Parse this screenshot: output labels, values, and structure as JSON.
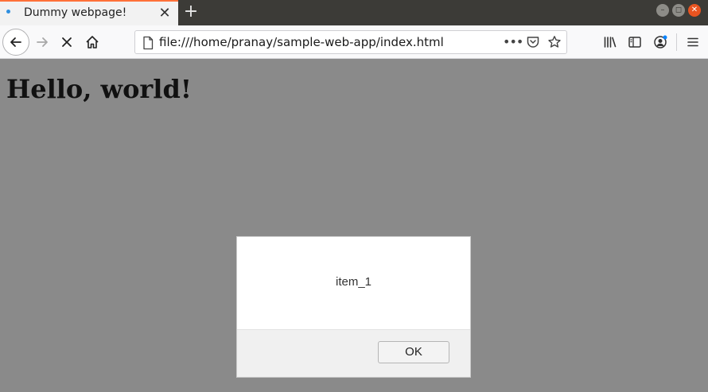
{
  "tab": {
    "title": "Dummy webpage!",
    "close_glyph": "✕",
    "dot_color": "#2f8fe0"
  },
  "new_tab_glyph": "+",
  "window_controls": {
    "minimize": "–",
    "maximize": "◻",
    "close": "✕"
  },
  "urlbar": {
    "url": "file:///home/pranay/sample-web-app/index.html",
    "more_glyph": "•••"
  },
  "icons": [
    "back-arrow-icon",
    "forward-arrow-icon",
    "stop-icon",
    "home-icon",
    "page-icon",
    "pocket-icon",
    "bookmark-star-icon",
    "library-icon",
    "sidebar-icon",
    "account-icon",
    "hamburger-menu-icon"
  ],
  "page": {
    "heading": "Hello, world!"
  },
  "dialog": {
    "message": "item_1",
    "ok_label": "OK"
  },
  "colors": {
    "accent": "#ff7139",
    "page_overlay": "#8a8a8a",
    "close_button": "#e95420"
  }
}
